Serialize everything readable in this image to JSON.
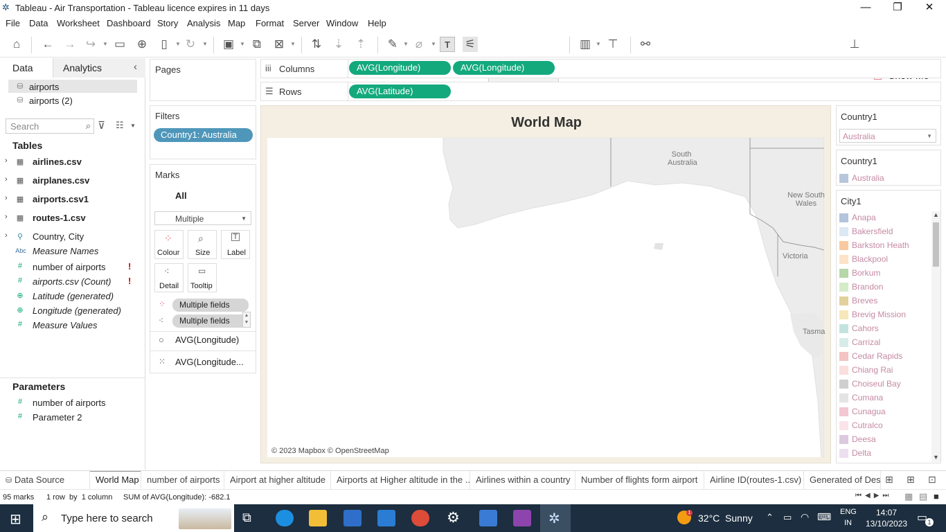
{
  "window": {
    "title": "Tableau - Air Transportation - Tableau licence expires in 11 days"
  },
  "menu": [
    "File",
    "Data",
    "Worksheet",
    "Dashboard",
    "Story",
    "Analysis",
    "Map",
    "Format",
    "Server",
    "Window",
    "Help"
  ],
  "toolbar": {
    "show_me": "Show Me"
  },
  "datapane": {
    "tabs": [
      "Data",
      "Analytics"
    ],
    "sources": [
      "airports",
      "airports (2)"
    ],
    "search_placeholder": "Search",
    "tables_header": "Tables",
    "tables": [
      "airlines.csv",
      "airplanes.csv",
      "airports.csv1",
      "routes-1.csv"
    ],
    "fields": [
      {
        "icon": "hierarchy-icon",
        "name": "Country, City"
      },
      {
        "icon": "abc-icon",
        "name": "Measure Names"
      },
      {
        "icon": "measure-icon",
        "name": "number of airports"
      },
      {
        "icon": "measure-icon",
        "name": "airports.csv (Count)"
      },
      {
        "icon": "globe-icon",
        "name": "Latitude (generated)"
      },
      {
        "icon": "globe-icon",
        "name": "Longitude (generated)"
      },
      {
        "icon": "measure-icon",
        "name": "Measure Values"
      }
    ],
    "icon_glyphs": {
      "abc": "Abc"
    },
    "parameters_header": "Parameters",
    "parameters": [
      "number of airports",
      "Parameter 2"
    ]
  },
  "cards": {
    "pages": "Pages",
    "filters": "Filters",
    "filter_pill": "Country1: Australia",
    "marks": "Marks",
    "marks_all": "All",
    "mark_type": "Multiple",
    "mark_buttons": [
      "Colour",
      "Size",
      "Label",
      "Detail",
      "Tooltip"
    ],
    "mark_fields": [
      "Multiple fields",
      "Multiple fields"
    ],
    "mark_layers": [
      "AVG(Longitude)",
      "AVG(Longitude..."
    ]
  },
  "shelves": {
    "columns_label": "Columns",
    "columns": [
      "AVG(Longitude)",
      "AVG(Longitude)"
    ],
    "rows_label": "Rows",
    "rows": [
      "AVG(Latitude)"
    ]
  },
  "viz": {
    "title": "World Map",
    "map_labels": [
      "South Australia",
      "New South Wales",
      "Victoria",
      "Tasma"
    ],
    "attribution": "© 2023 Mapbox © OpenStreetMap"
  },
  "legends": {
    "filter_title": "Country1",
    "filter_value": "Australia",
    "color_title": "Country1",
    "color_items": [
      {
        "label": "Australia",
        "color": "#b8c6dc"
      }
    ],
    "city_title": "City1",
    "city_items": [
      {
        "label": "Anapa",
        "color": "#b3c4dc"
      },
      {
        "label": "Bakersfield",
        "color": "#dce8f4"
      },
      {
        "label": "Barkston Heath",
        "color": "#f8c9a0"
      },
      {
        "label": "Blackpool",
        "color": "#fde3c7"
      },
      {
        "label": "Borkum",
        "color": "#b6d7a8"
      },
      {
        "label": "Brandon",
        "color": "#d5ecc8"
      },
      {
        "label": "Breves",
        "color": "#e2d19d"
      },
      {
        "label": "Brevig Mission",
        "color": "#f7e8bb"
      },
      {
        "label": "Cahors",
        "color": "#c3e3df"
      },
      {
        "label": "Carrizal",
        "color": "#d7ece9"
      },
      {
        "label": "Cedar Rapids",
        "color": "#f4c3c3"
      },
      {
        "label": "Chiang Rai",
        "color": "#fbdede"
      },
      {
        "label": "Choiseul Bay",
        "color": "#cfcfcf"
      },
      {
        "label": "Cumana",
        "color": "#e4e4e4"
      },
      {
        "label": "Cunagua",
        "color": "#f2c7d3"
      },
      {
        "label": "Cutralco",
        "color": "#fbe3ea"
      },
      {
        "label": "Deesa",
        "color": "#dcc8df"
      },
      {
        "label": "Delta",
        "color": "#ecdff0"
      }
    ]
  },
  "sheet_tabs": [
    "Data Source",
    "World Map",
    "number of airports",
    "Airport at higher altitude",
    "Airports at Higher altitude in the ...",
    "Airlines within a country",
    "Number of flights form airport",
    "Airline ID(routes-1.csv)",
    "Generated of Dest"
  ],
  "status": {
    "marks": "95 marks",
    "rows": "1 row  by  1 column",
    "sum": "SUM of AVG(Longitude): -682.1"
  },
  "taskbar": {
    "search_placeholder": "Type here to search",
    "weather": "32°C  Sunny",
    "lang1": "ENG",
    "lang2": "IN",
    "time": "14:07",
    "date": "13/10/2023",
    "notif": "1",
    "badge": "1"
  }
}
